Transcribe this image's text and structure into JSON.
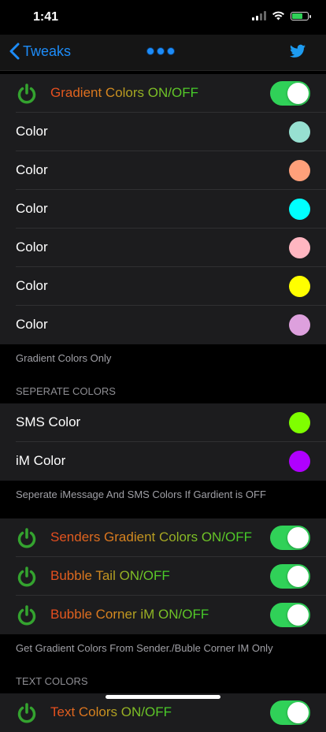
{
  "status": {
    "time": "1:41"
  },
  "nav": {
    "back_label": "Tweaks"
  },
  "colors": {
    "accent": "#1d8cf8",
    "toggle_on": "#30d158",
    "power_icon": "#34a32f",
    "twitter": "#1d9bf0"
  },
  "group1": {
    "toggle_label": "Gradient Colors ON/OFF",
    "toggle_on": true,
    "colors": [
      {
        "label": "Color",
        "color": "#97e0d1"
      },
      {
        "label": "Color",
        "color": "#ffa07a"
      },
      {
        "label": "Color",
        "color": "#00ffff"
      },
      {
        "label": "Color",
        "color": "#ffb6c1"
      },
      {
        "label": "Color",
        "color": "#ffff00"
      },
      {
        "label": "Color",
        "color": "#dda0dd"
      }
    ],
    "footer": "Gradient Colors Only"
  },
  "separate": {
    "header": "SEPERATE COLORS",
    "rows": [
      {
        "label": "SMS Color",
        "color": "#7fff00"
      },
      {
        "label": "iM Color",
        "color": "#b000ff"
      }
    ],
    "footer": "Seperate iMessage And SMS Colors If Gardient is OFF"
  },
  "senders": {
    "rows": [
      {
        "label": "Senders Gradient Colors ON/OFF",
        "on": true
      },
      {
        "label": "Bubble Tail ON/OFF",
        "on": true
      },
      {
        "label": "Bubble Corner iM ON/OFF",
        "on": true
      }
    ],
    "footer": "Get Gradient Colors From Sender./Buble Corner IM Only"
  },
  "text_colors": {
    "header": "TEXT COLORS",
    "rows": [
      {
        "label": "Text Colors ON/OFF",
        "on": true
      }
    ]
  }
}
